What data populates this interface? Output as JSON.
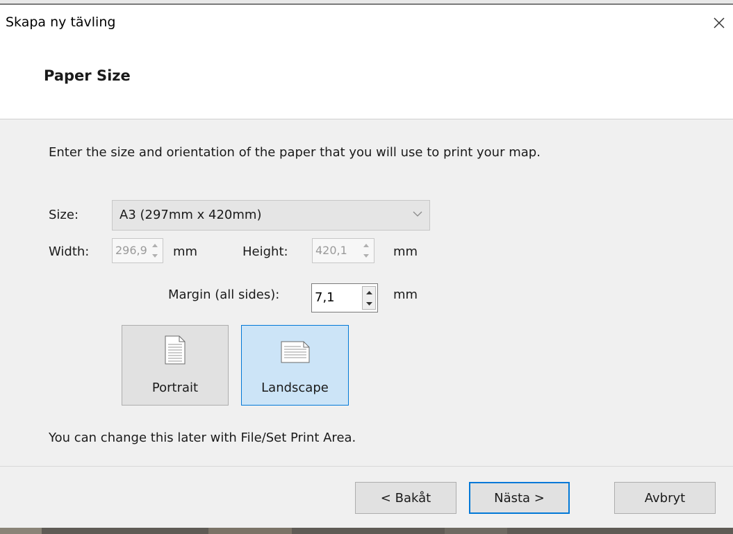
{
  "window": {
    "title": "Skapa ny tävling",
    "close_icon": "close-icon"
  },
  "header": {
    "heading": "Paper Size"
  },
  "content": {
    "instruction": "Enter the size and orientation of the paper that you will use to print your map.",
    "size": {
      "label": "Size:",
      "selected": "A3 (297mm x 420mm)",
      "icon": "chevron-down-icon"
    },
    "width": {
      "label": "Width:",
      "value": "296,9",
      "unit": "mm",
      "enabled": false
    },
    "height": {
      "label": "Height:",
      "value": "420,1",
      "unit": "mm",
      "enabled": false
    },
    "margin": {
      "label": "Margin (all sides):",
      "value": "7,1",
      "unit": "mm",
      "enabled": true
    },
    "orientation": {
      "portrait": {
        "label": "Portrait",
        "icon": "portrait-page-icon",
        "selected": false
      },
      "landscape": {
        "label": "Landscape",
        "icon": "landscape-page-icon",
        "selected": true
      }
    },
    "note": "You can change this later with File/Set Print Area."
  },
  "footer": {
    "back_label": "< Bakåt",
    "next_label": "Nästa >",
    "cancel_label": "Avbryt"
  },
  "colors": {
    "accent": "#0078d7",
    "selected_bg": "#cce4f7",
    "dialog_bg": "#f0f0f0"
  }
}
